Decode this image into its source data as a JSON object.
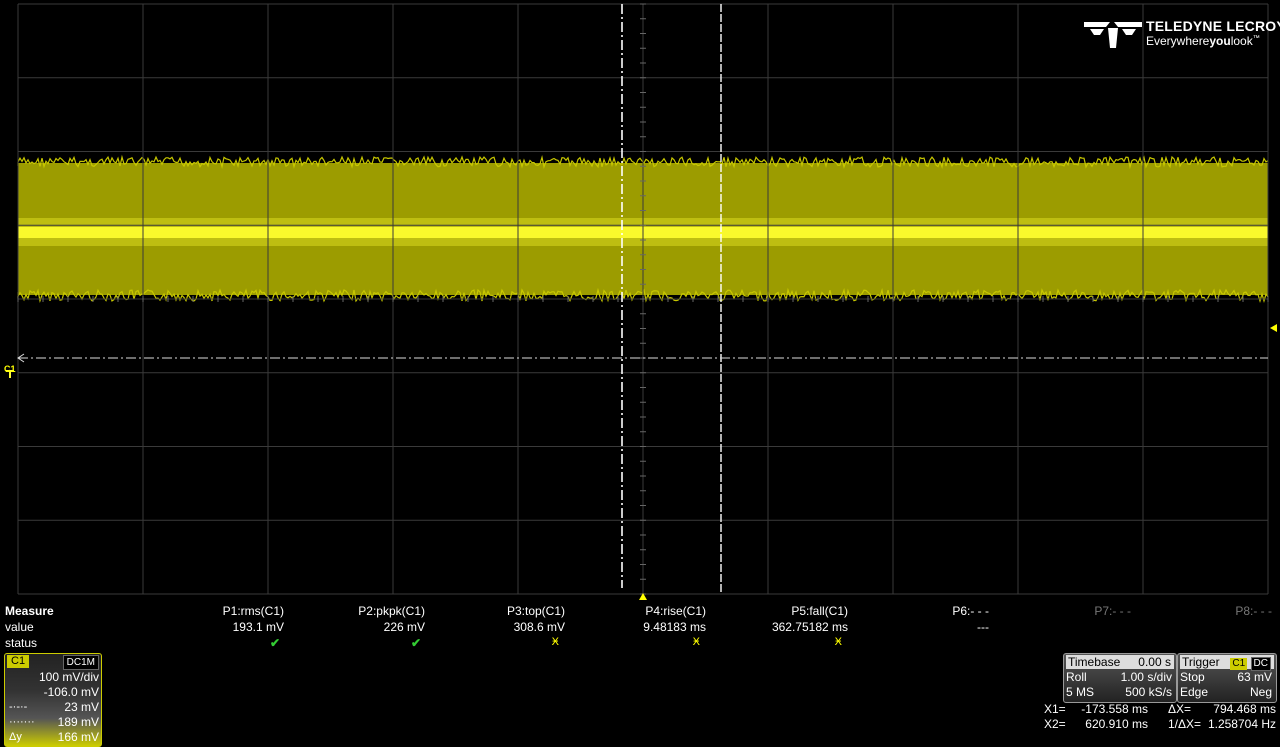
{
  "logo": {
    "brand": "TELEDYNE LECROY",
    "tagline_pre": "Everywhere",
    "tagline_bold": "you",
    "tagline_post": "look",
    "tm": "™"
  },
  "channel_marker": "C1",
  "colors": {
    "trace": "#c8c800",
    "trace_bright": "#ffff30",
    "grid": "#3a3a3a",
    "background": "#000000"
  },
  "measure": {
    "title": "Measure",
    "row_value": "value",
    "row_status": "status",
    "params": [
      {
        "name": "P1:rms(C1)",
        "value": "193.1 mV",
        "status": "ok"
      },
      {
        "name": "P2:pkpk(C1)",
        "value": "226 mV",
        "status": "ok"
      },
      {
        "name": "P3:top(C1)",
        "value": "308.6 mV",
        "status": "warn"
      },
      {
        "name": "P4:rise(C1)",
        "value": "9.48183 ms",
        "status": "warn"
      },
      {
        "name": "P5:fall(C1)",
        "value": "362.75182 ms",
        "status": "warn"
      },
      {
        "name": "P6:- - -",
        "value": "---",
        "status": ""
      },
      {
        "name": "P7:- - -",
        "value": "",
        "status": ""
      },
      {
        "name": "P8:- - -",
        "value": "",
        "status": ""
      }
    ]
  },
  "channel": {
    "label": "C1",
    "coupling": "DC1M",
    "vdiv": "100 mV/div",
    "offset": "-106.0 mV",
    "cursor1_value": "23 mV",
    "cursor2_value": "189 mV",
    "delta_label": "Δy",
    "delta_value": "166 mV"
  },
  "timebase": {
    "title": "Timebase",
    "delay": "0.00 s",
    "mode": "Roll",
    "tdiv": "1.00 s/div",
    "samples": "5 MS",
    "rate": "500 kS/s"
  },
  "trigger": {
    "title": "Trigger",
    "source": "C1",
    "coupling": "DC",
    "state": "Stop",
    "level": "63 mV",
    "type": "Edge",
    "slope": "Neg"
  },
  "cursors": {
    "x1_label": "X1=",
    "x1": "-173.558 ms",
    "dx_label": "ΔX=",
    "dx": "794.468 ms",
    "x2_label": "X2=",
    "x2": "620.910 ms",
    "inv_label": "1/ΔX=",
    "inv": "1.258704 Hz"
  }
}
